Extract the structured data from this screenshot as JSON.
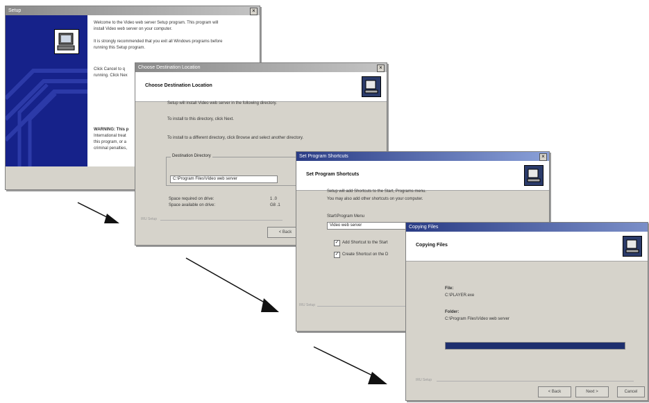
{
  "window1": {
    "title": "Setup",
    "welcome_line1": "Welcome to the Video web server Setup program. This program will",
    "welcome_line2": "install Video web server on your computer.",
    "recommend_line1": "It is strongly recommended that you exit all Windows programs before",
    "recommend_line2": "running this Setup program.",
    "cancel_line1": "Click Cancel to q",
    "cancel_line2": "running. Click Nex",
    "warning_line1": "WARNING: This p",
    "warning_line2": "International treat",
    "warning_line3": "this program, or a",
    "warning_line4": "criminal penalties,"
  },
  "window2": {
    "title": "Choose Destination Location",
    "heading": "Choose Destination Location",
    "line1": "Setup will install Video web server in the following directory.",
    "line2": "To install to this directory, click Next.",
    "line3": "To install to a different directory, click Browse and select another directory.",
    "group_label": "Destination Directory",
    "dest_value": "C:\\Program Files\\Video web server",
    "space_required_label": "Space required on drive:",
    "space_available_label": "Space available on drive:",
    "space_required_value": "1 .0",
    "space_available_value": "G8 .1",
    "brand": "IRU Setup",
    "next_label": "< Back"
  },
  "window3": {
    "title": "Set Program Shortcuts",
    "heading": "Set Program Shortcuts",
    "line1": "Setup will add Shortcuts to the Start, Programs menu.",
    "line2": "You may also add other shortcuts on your computer.",
    "menu_label": "Start\\Program Menu",
    "menu_value": "Video web server",
    "check1_label": "Add Shortcut to the Start",
    "check2_label": "Create Shortcut on the D",
    "brand": "IRU Setup"
  },
  "window4": {
    "title": "Copying Files",
    "heading": "Copying Files",
    "file_label": "File:",
    "file_value": "C:\\PLAYER.exe",
    "folder_label": "Folder:",
    "folder_value": "C:\\Program Files\\Video web server",
    "progress": 1.0,
    "brand": "IRU Setup",
    "back_label": "< Back",
    "next_label": "Next >",
    "cancel_label": "Cancel"
  },
  "colors": {
    "title_active": "#2a3c85",
    "progress_fill": "#1e2f6e",
    "dialog_bg": "#d6d3cb"
  }
}
